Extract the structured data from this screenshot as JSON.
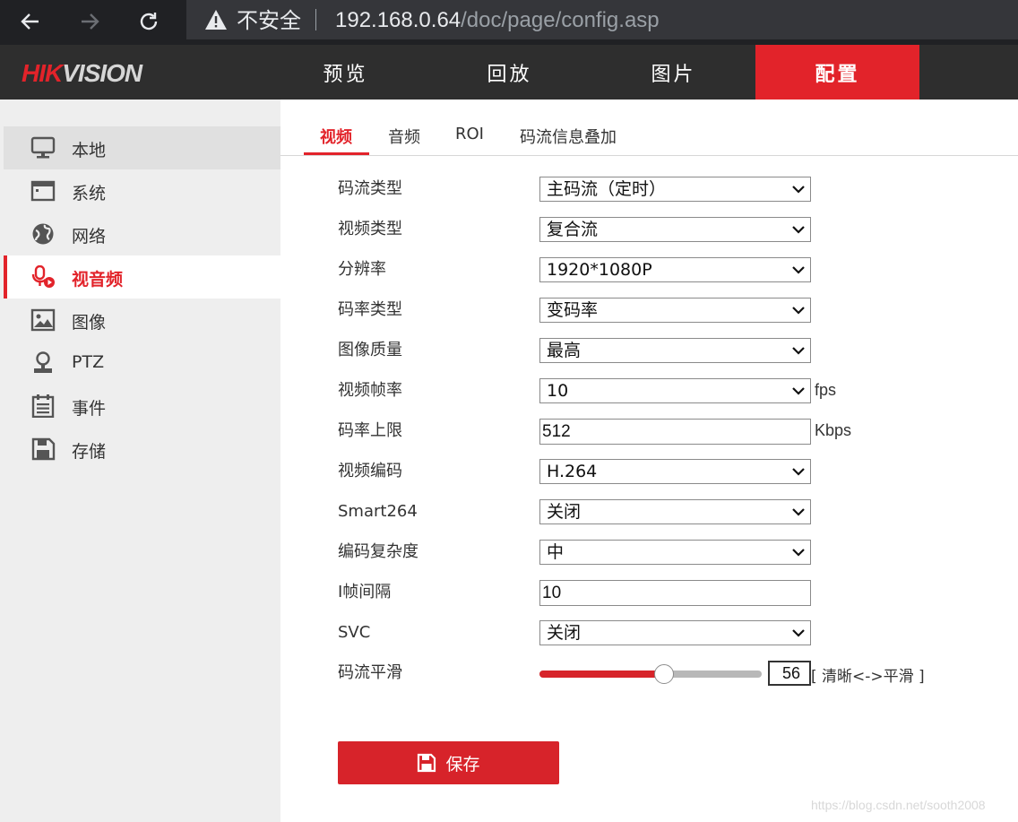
{
  "browser": {
    "security_label": "不安全",
    "url_host": "192.168.0.64",
    "url_path": "/doc/page/config.asp"
  },
  "header": {
    "logo_hik": "HIK",
    "logo_vision": "VISION",
    "nav": [
      {
        "label": "预览",
        "active": false
      },
      {
        "label": "回放",
        "active": false
      },
      {
        "label": "图片",
        "active": false
      },
      {
        "label": "配置",
        "active": true
      }
    ]
  },
  "sidebar": {
    "items": [
      {
        "label": "本地",
        "icon": "monitor-icon"
      },
      {
        "label": "系统",
        "icon": "window-icon"
      },
      {
        "label": "网络",
        "icon": "globe-icon"
      },
      {
        "label": "视音频",
        "icon": "mic-video-icon",
        "active": true
      },
      {
        "label": "图像",
        "icon": "image-icon"
      },
      {
        "label": "PTZ",
        "icon": "ptz-icon"
      },
      {
        "label": "事件",
        "icon": "calendar-list-icon"
      },
      {
        "label": "存储",
        "icon": "floppy-icon"
      }
    ]
  },
  "tabs": [
    {
      "label": "视频",
      "active": true
    },
    {
      "label": "音频"
    },
    {
      "label": "ROI"
    },
    {
      "label": "码流信息叠加"
    }
  ],
  "form": {
    "stream_type": {
      "label": "码流类型",
      "value": "主码流（定时）"
    },
    "video_type": {
      "label": "视频类型",
      "value": "复合流"
    },
    "resolution": {
      "label": "分辨率",
      "value": "1920*1080P"
    },
    "bitrate_type": {
      "label": "码率类型",
      "value": "变码率"
    },
    "image_quality": {
      "label": "图像质量",
      "value": "最高"
    },
    "frame_rate": {
      "label": "视频帧率",
      "value": "10",
      "unit": "fps"
    },
    "max_bitrate": {
      "label": "码率上限",
      "value": "512",
      "unit": "Kbps"
    },
    "video_encoding": {
      "label": "视频编码",
      "value": "H.264"
    },
    "smart264": {
      "label": "Smart264",
      "value": "关闭"
    },
    "encoding_complexity": {
      "label": "编码复杂度",
      "value": "中"
    },
    "i_frame_interval": {
      "label": "I帧间隔",
      "value": "10"
    },
    "svc": {
      "label": "SVC",
      "value": "关闭"
    },
    "smoothing": {
      "label": "码流平滑",
      "value": "56",
      "percent": 0.56,
      "hint": "[ 清晰<->平滑 ]"
    }
  },
  "save_label": "保存",
  "watermark": "https://blog.csdn.net/sooth2008",
  "colors": {
    "accent": "#e2232a",
    "header_bg": "#2e2e2e",
    "sidebar_bg": "#eeeeee"
  }
}
